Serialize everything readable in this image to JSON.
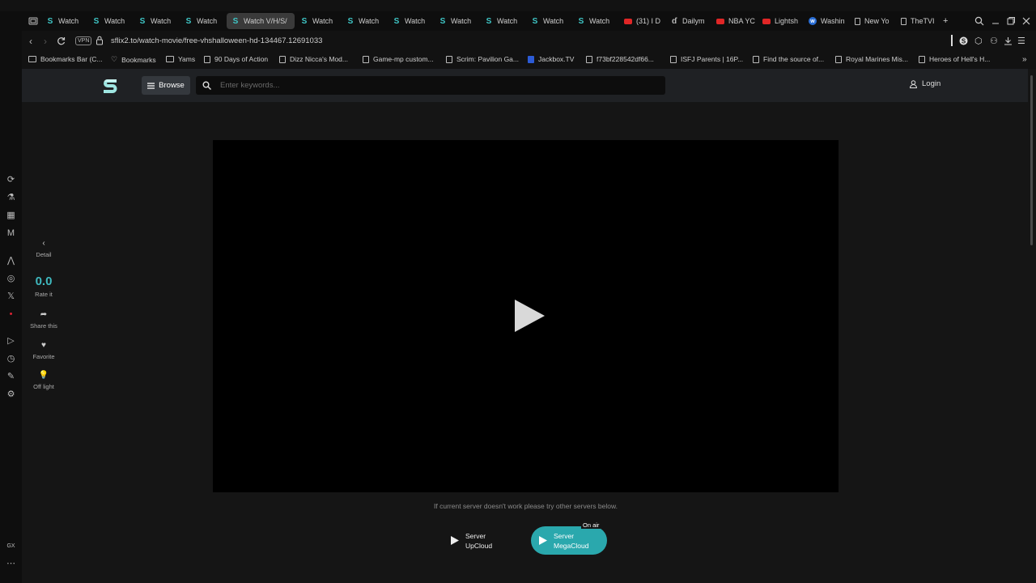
{
  "browser": {
    "tabs": [
      {
        "label": "Watch",
        "favicon": "s-logo-icon"
      },
      {
        "label": "Watch",
        "favicon": "s-logo-icon"
      },
      {
        "label": "Watch",
        "favicon": "s-logo-icon"
      },
      {
        "label": "Watch",
        "favicon": "s-logo-icon"
      },
      {
        "label": "Watch V/H/S/",
        "favicon": "s-logo-icon",
        "active": true
      },
      {
        "label": "Watch",
        "favicon": "s-logo-icon"
      },
      {
        "label": "Watch",
        "favicon": "s-logo-icon"
      },
      {
        "label": "Watch",
        "favicon": "s-logo-icon"
      },
      {
        "label": "Watch",
        "favicon": "s-logo-icon"
      },
      {
        "label": "Watch",
        "favicon": "s-logo-icon"
      },
      {
        "label": "Watch",
        "favicon": "s-logo-icon"
      },
      {
        "label": "Watch",
        "favicon": "s-logo-icon"
      },
      {
        "label": "(31) I D",
        "favicon": "youtube-icon"
      },
      {
        "label": "Dailym",
        "favicon": "dailymotion-icon"
      },
      {
        "label": "NBA YC",
        "favicon": "youtube-icon"
      },
      {
        "label": "Lightsh",
        "favicon": "youtube-icon"
      },
      {
        "label": "Washin",
        "favicon": "washington-post-icon"
      },
      {
        "label": "New Yo",
        "favicon": "document-icon"
      },
      {
        "label": "TheTVI",
        "favicon": "document-icon"
      }
    ],
    "new_tab_label": "+",
    "url": "sflix2.to/watch-movie/free-vhshalloween-hd-134467.12691033",
    "vpn_label": "VPN",
    "bookmarks": [
      {
        "label": "Bookmarks Bar (C...",
        "icon": "folder-icon"
      },
      {
        "label": "Bookmarks",
        "icon": "heart-icon"
      },
      {
        "label": "Yams",
        "icon": "folder-icon"
      },
      {
        "label": "90 Days of Action",
        "icon": "document-icon"
      },
      {
        "label": "Dizz Nicca's Mod...",
        "icon": "document-icon"
      },
      {
        "label": "Game-mp custom...",
        "icon": "document-icon"
      },
      {
        "label": "Scrim: Pavilion Ga...",
        "icon": "document-icon"
      },
      {
        "label": "Jackbox.TV",
        "icon": "jackbox-icon"
      },
      {
        "label": "f73bf228542df66...",
        "icon": "document-icon"
      },
      {
        "label": "ISFJ Parents | 16P...",
        "icon": "document-icon"
      },
      {
        "label": "Find the source of...",
        "icon": "document-icon"
      },
      {
        "label": "Royal Marines Mis...",
        "icon": "document-icon"
      },
      {
        "label": "Heroes of Hell's H...",
        "icon": "document-icon"
      }
    ],
    "sidebar_bottom_label": "GX"
  },
  "site": {
    "browse_label": "Browse",
    "search_placeholder": "Enter keywords...",
    "login_label": "Login",
    "accent_color": "#2aa8ad",
    "side_actions": {
      "detail": "Detail",
      "rating_value": "0.0",
      "rate_it": "Rate it",
      "share": "Share this",
      "favorite": "Favorite",
      "off_light": "Off light"
    },
    "server_note": "If current server doesn't work please try other servers below.",
    "servers": [
      {
        "line1": "Server",
        "line2": "UpCloud"
      },
      {
        "line1": "Server",
        "line2": "MegaCloud"
      }
    ],
    "on_air_label": "On air"
  }
}
